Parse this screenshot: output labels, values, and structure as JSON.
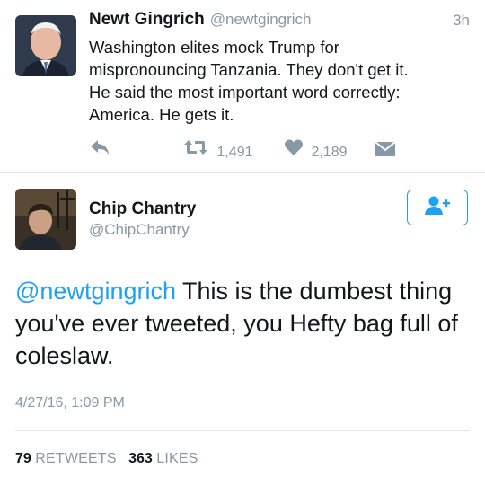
{
  "tweet1": {
    "name": "Newt Gingrich",
    "handle": "@newtgingrich",
    "time": "3h",
    "lines": [
      "Washington elites mock Trump for",
      "mispronouncing Tanzania. They don't get it.",
      "He said the most important word correctly:",
      "America. He gets it."
    ],
    "retweets": "1,491",
    "likes": "2,189",
    "icons": [
      "reply-icon",
      "retweet-icon",
      "like-icon",
      "direct-message-icon"
    ]
  },
  "tweet2": {
    "name": "Chip Chantry",
    "handle": "@ChipChantry",
    "mention": "@newtgingrich",
    "line1_rest": " This is the dumbest thing",
    "line2": "you've ever tweeted, you Hefty bag full of",
    "line3": "coleslaw.",
    "date": "4/27/16, 1:09 PM",
    "retweet_count": "79",
    "retweet_label": "RETWEETS",
    "like_count": "363",
    "like_label": "LIKES",
    "follow_icon": "follow-user-icon"
  },
  "colors": {
    "accent": "#1da1f2",
    "muted": "#8899a6",
    "text": "#14171a",
    "divider": "#e1e8ed"
  }
}
